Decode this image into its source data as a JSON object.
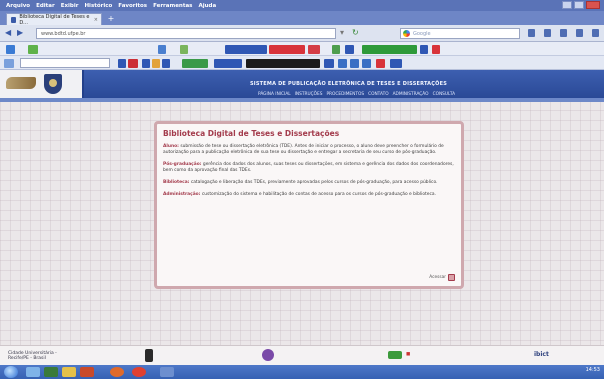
{
  "browser": {
    "menus": [
      "Arquivo",
      "Editar",
      "Exibir",
      "Histórico",
      "Favoritos",
      "Ferramentas",
      "Ajuda"
    ],
    "tab_title": "Biblioteca Digital de Teses e D...",
    "url": "www.bdtd.ufpe.br",
    "search_placeholder": "Google",
    "new_tab_label": "+"
  },
  "site": {
    "title": "SISTEMA DE PUBLICAÇÃO ELETRÔNICA DE TESES E DISSERTAÇÕES",
    "links": [
      "PÁGINA INICIAL",
      "INSTRUÇÕES",
      "PROCEDIMENTOS",
      "CONTATO",
      "ADMINISTRAÇÃO",
      "CONSULTA"
    ]
  },
  "card": {
    "title": "Biblioteca Digital de Teses e Dissertações",
    "items": [
      {
        "label": "Aluno:",
        "text": "submissão de tese ou dissertação eletrônica (TDE). Antes de iniciar o processo, o aluno deve preencher o formulário de autorização para a publicação eletrônica de sua tese ou dissertação e entregar a secretaria de seu curso de pós-graduação."
      },
      {
        "label": "Pós-graduação:",
        "text": "gerência dos dados dos alunos, suas teses ou dissertações, em sistema e gerência dos dados dos coordenadores, bem como da aprovação final das TDEs."
      },
      {
        "label": "Biblioteca:",
        "text": "catalogação e liberação das TDEs, previamente aprovadas pelos cursos de pós-graduação, para acesso público."
      },
      {
        "label": "Administração:",
        "text": "customização do sistema e habilitação de contas de acesso para os cursos de pós-graduação e biblioteca."
      }
    ],
    "button_label": "Acessar"
  },
  "footer": {
    "left_text": "Cidade Universitária - Recife/PE - Brasil",
    "ibict_label": "ibict"
  },
  "taskbar": {
    "time": "14:53"
  },
  "colors": {
    "header_blue": "#2f52a4",
    "accent": "#a33b4c"
  }
}
